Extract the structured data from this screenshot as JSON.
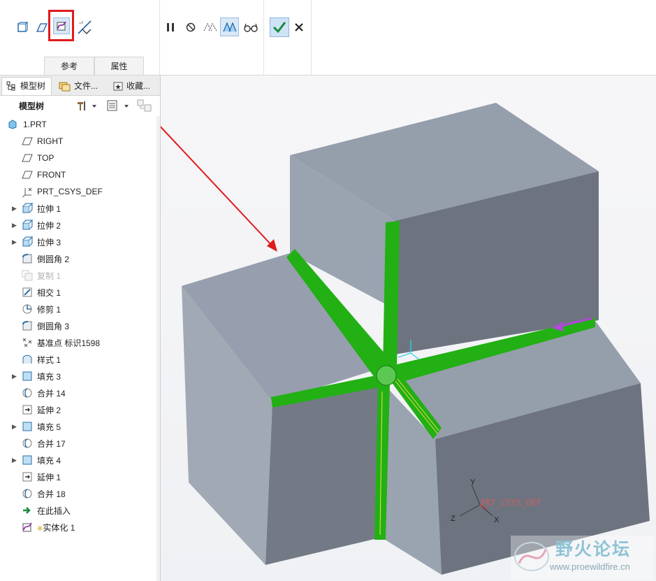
{
  "toolbar": {
    "left_tools": [
      "solid-icon",
      "surface-icon",
      "curve-icon",
      "trim-icon"
    ],
    "right_tools": [
      "pause-icon",
      "no-preview-icon",
      "preview-icon",
      "verify-icon",
      "glasses-icon"
    ],
    "ok_icon": "checkmark-icon",
    "cancel_icon": "close-icon"
  },
  "dashboard_tabs": [
    {
      "label": "参考"
    },
    {
      "label": "属性"
    }
  ],
  "panel_tabs": [
    {
      "label": "模型树"
    },
    {
      "label": "文件..."
    },
    {
      "label": "收藏..."
    }
  ],
  "tree_header": {
    "title": "模型树"
  },
  "tree": [
    {
      "label": "1.PRT",
      "icon": "part-icon"
    },
    {
      "label": "RIGHT",
      "icon": "datum-plane-icon"
    },
    {
      "label": "TOP",
      "icon": "datum-plane-icon"
    },
    {
      "label": "FRONT",
      "icon": "datum-plane-icon"
    },
    {
      "label": "PRT_CSYS_DEF",
      "icon": "csys-icon"
    },
    {
      "label": "拉伸 1",
      "icon": "extrude-icon",
      "expandable": true
    },
    {
      "label": "拉伸 2",
      "icon": "extrude-icon",
      "expandable": true
    },
    {
      "label": "拉伸 3",
      "icon": "extrude-icon",
      "expandable": true
    },
    {
      "label": "倒圆角 2",
      "icon": "round-icon"
    },
    {
      "label": "复制 1",
      "icon": "copy-icon",
      "dim": true
    },
    {
      "label": "相交 1",
      "icon": "intersect-icon"
    },
    {
      "label": "修剪 1",
      "icon": "trim-feature-icon"
    },
    {
      "label": "倒圆角 3",
      "icon": "round-icon"
    },
    {
      "label": "基准点 标识1598",
      "icon": "datum-point-icon"
    },
    {
      "label": "样式 1",
      "icon": "style-icon"
    },
    {
      "label": "填充 3",
      "icon": "fill-icon",
      "expandable": true
    },
    {
      "label": "合并 14",
      "icon": "merge-icon"
    },
    {
      "label": "延伸 2",
      "icon": "extend-icon"
    },
    {
      "label": "填充 5",
      "icon": "fill-icon",
      "expandable": true
    },
    {
      "label": "合并 17",
      "icon": "merge-icon"
    },
    {
      "label": "填充 4",
      "icon": "fill-icon",
      "expandable": true
    },
    {
      "label": "延伸 1",
      "icon": "extend-icon"
    },
    {
      "label": "合并 18",
      "icon": "merge-icon"
    },
    {
      "label": "在此插入",
      "icon": "insert-here-icon"
    },
    {
      "label": "实体化 1",
      "icon": "solidify-icon",
      "prefix": "※"
    }
  ],
  "viewport": {
    "csys_label": "PRT_CSYS_DEF",
    "axes": {
      "x": "X",
      "y": "Y",
      "z": "Z"
    },
    "colors": {
      "body": "#9ca3ae",
      "round": "#22b014",
      "annotation": "#e01b1b",
      "direction_arrow": "#b048d8"
    }
  },
  "watermark": {
    "text": "野火论坛",
    "url": "www.proewildfire.cn"
  }
}
